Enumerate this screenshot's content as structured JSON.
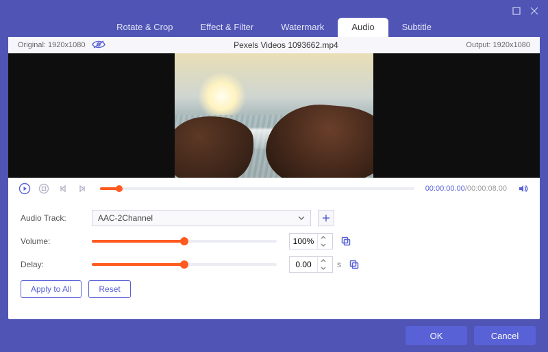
{
  "window": {
    "maximize_label": "Maximize",
    "close_label": "Close"
  },
  "tabs": [
    {
      "label": "Rotate & Crop"
    },
    {
      "label": "Effect & Filter"
    },
    {
      "label": "Watermark"
    },
    {
      "label": "Audio"
    },
    {
      "label": "Subtitle"
    }
  ],
  "active_tab_index": 3,
  "infobar": {
    "original_label": "Original:",
    "original_value": "1920x1080",
    "filename": "Pexels Videos 1093662.mp4",
    "output_label": "Output:",
    "output_value": "1920x1080"
  },
  "playback": {
    "current": "00:00:00.00",
    "duration": "00:00:08.00",
    "position_percent": 6
  },
  "form": {
    "audio_track_label": "Audio Track:",
    "audio_track_value": "AAC-2Channel",
    "volume_label": "Volume:",
    "volume_value": "100%",
    "volume_percent": 50,
    "delay_label": "Delay:",
    "delay_value": "0.00",
    "delay_unit": "s",
    "delay_percent": 50
  },
  "buttons": {
    "apply_all": "Apply to All",
    "reset": "Reset",
    "ok": "OK",
    "cancel": "Cancel"
  }
}
